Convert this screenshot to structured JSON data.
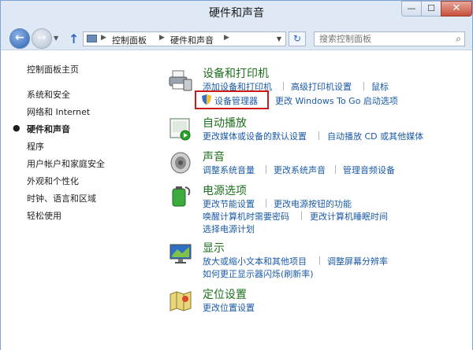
{
  "window": {
    "title": "硬件和声音"
  },
  "title_buttons": {
    "minimize": "—",
    "maximize": "☐",
    "close": "✕"
  },
  "nav": {
    "back": "←",
    "forward": "→",
    "up": "↑",
    "refresh": "↻",
    "breadcrumb": [
      "控制面板",
      "硬件和声音"
    ],
    "search_placeholder": "搜索控制面板",
    "search_icon": "⌕"
  },
  "sidebar": {
    "home": "控制面板主页",
    "items": [
      "系统和安全",
      "网络和 Internet",
      "硬件和声音",
      "程序",
      "用户帐户和家庭安全",
      "外观和个性化",
      "时钟、语言和区域",
      "轻松使用"
    ],
    "current_index": 2
  },
  "categories": [
    {
      "title": "设备和打印机",
      "icon": "printer-icon",
      "links": [
        "添加设备和打印机",
        "高级打印机设置",
        "鼠标",
        "设备管理器",
        "更改 Windows To Go 启动选项"
      ]
    },
    {
      "title": "自动播放",
      "icon": "autoplay-icon",
      "links": [
        "更改媒体或设备的默认设置",
        "自动播放 CD 或其他媒体"
      ]
    },
    {
      "title": "声音",
      "icon": "speaker-icon",
      "links": [
        "调整系统音量",
        "更改系统声音",
        "管理音频设备"
      ]
    },
    {
      "title": "电源选项",
      "icon": "battery-icon",
      "links": [
        "更改节能设置",
        "更改电源按钮的功能",
        "唤醒计算机时需要密码",
        "更改计算机睡眠时间",
        "选择电源计划"
      ]
    },
    {
      "title": "显示",
      "icon": "monitor-icon",
      "links": [
        "放大或缩小文本和其他项目",
        "调整屏幕分辨率",
        "如何更正显示器闪烁(刷新率)"
      ]
    },
    {
      "title": "定位设置",
      "icon": "location-icon",
      "links": [
        "更改位置设置"
      ]
    }
  ],
  "colors": {
    "category_title": "#1e6f1e",
    "link": "#1a5aa6",
    "highlight_box": "#cc1a1a"
  }
}
